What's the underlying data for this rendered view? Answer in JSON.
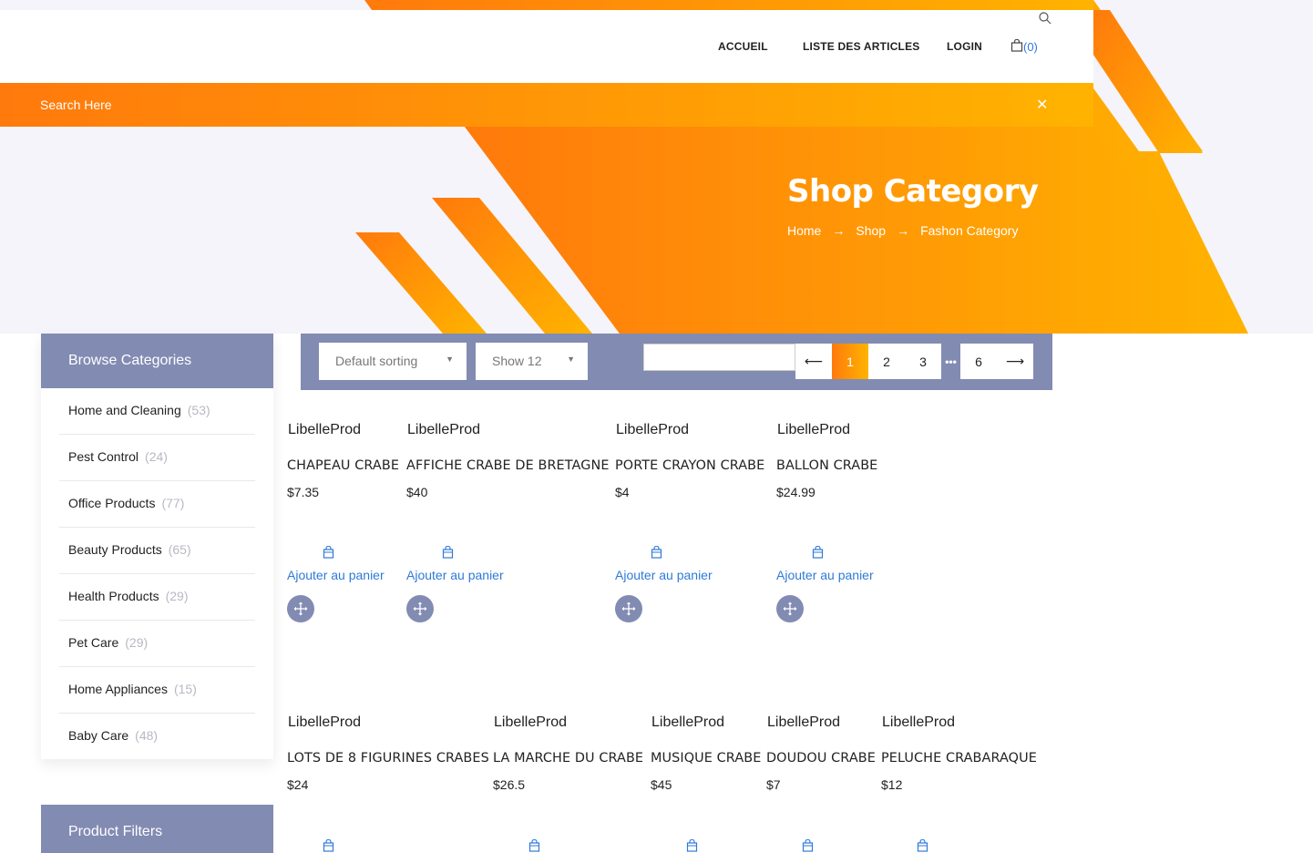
{
  "header": {
    "nav": [
      "ACCUEIL",
      "LISTE DES ARTICLES",
      "LOGIN"
    ],
    "cart_count": "(0)"
  },
  "search": {
    "label": "Search Here",
    "close": "✕"
  },
  "banner": {
    "title": "Shop Category",
    "breadcrumb": [
      "Home",
      "Shop",
      "Fashon Category"
    ]
  },
  "sidebar": {
    "categories_title": "Browse Categories",
    "categories": [
      {
        "label": "Home and Cleaning",
        "count": "(53)"
      },
      {
        "label": "Pest Control",
        "count": "(24)"
      },
      {
        "label": "Office Products",
        "count": "(77)"
      },
      {
        "label": "Beauty Products",
        "count": "(65)"
      },
      {
        "label": "Health Products",
        "count": "(29)"
      },
      {
        "label": "Pet Care",
        "count": "(29)"
      },
      {
        "label": "Home Appliances",
        "count": "(15)"
      },
      {
        "label": "Baby Care",
        "count": "(48)"
      }
    ],
    "filters_title": "Product Filters"
  },
  "toolbar": {
    "sorting": "Default sorting",
    "show": "Show 12",
    "pages": [
      "1",
      "2",
      "3",
      "6"
    ],
    "active_page": "1"
  },
  "product_image_alt": "LibelleProd",
  "add_to_cart_label": "Ajouter au panier",
  "products_row1": [
    {
      "name": "CHAPEAU CRABE",
      "price": "$7.35"
    },
    {
      "name": "AFFICHE CRABE DE BRETAGNE",
      "price": "$40"
    },
    {
      "name": "PORTE CRAYON CRABE",
      "price": "$4"
    },
    {
      "name": "BALLON CRABE",
      "price": "$24.99"
    }
  ],
  "products_row2": [
    {
      "name": "LOTS DE 8 FIGURINES CRABES",
      "price": "$24"
    },
    {
      "name": "LA MARCHE DU CRABE",
      "price": "$26.5"
    },
    {
      "name": "MUSIQUE CRABE",
      "price": "$45"
    },
    {
      "name": "DOUDOU CRABE",
      "price": "$7"
    },
    {
      "name": "PELUCHE CRABARAQUE",
      "price": "$12"
    }
  ],
  "colors": {
    "orange_start": "#ff7a0c",
    "orange_end": "#ffb300",
    "slate": "#828bb2",
    "link_blue": "#2f7ad8"
  }
}
